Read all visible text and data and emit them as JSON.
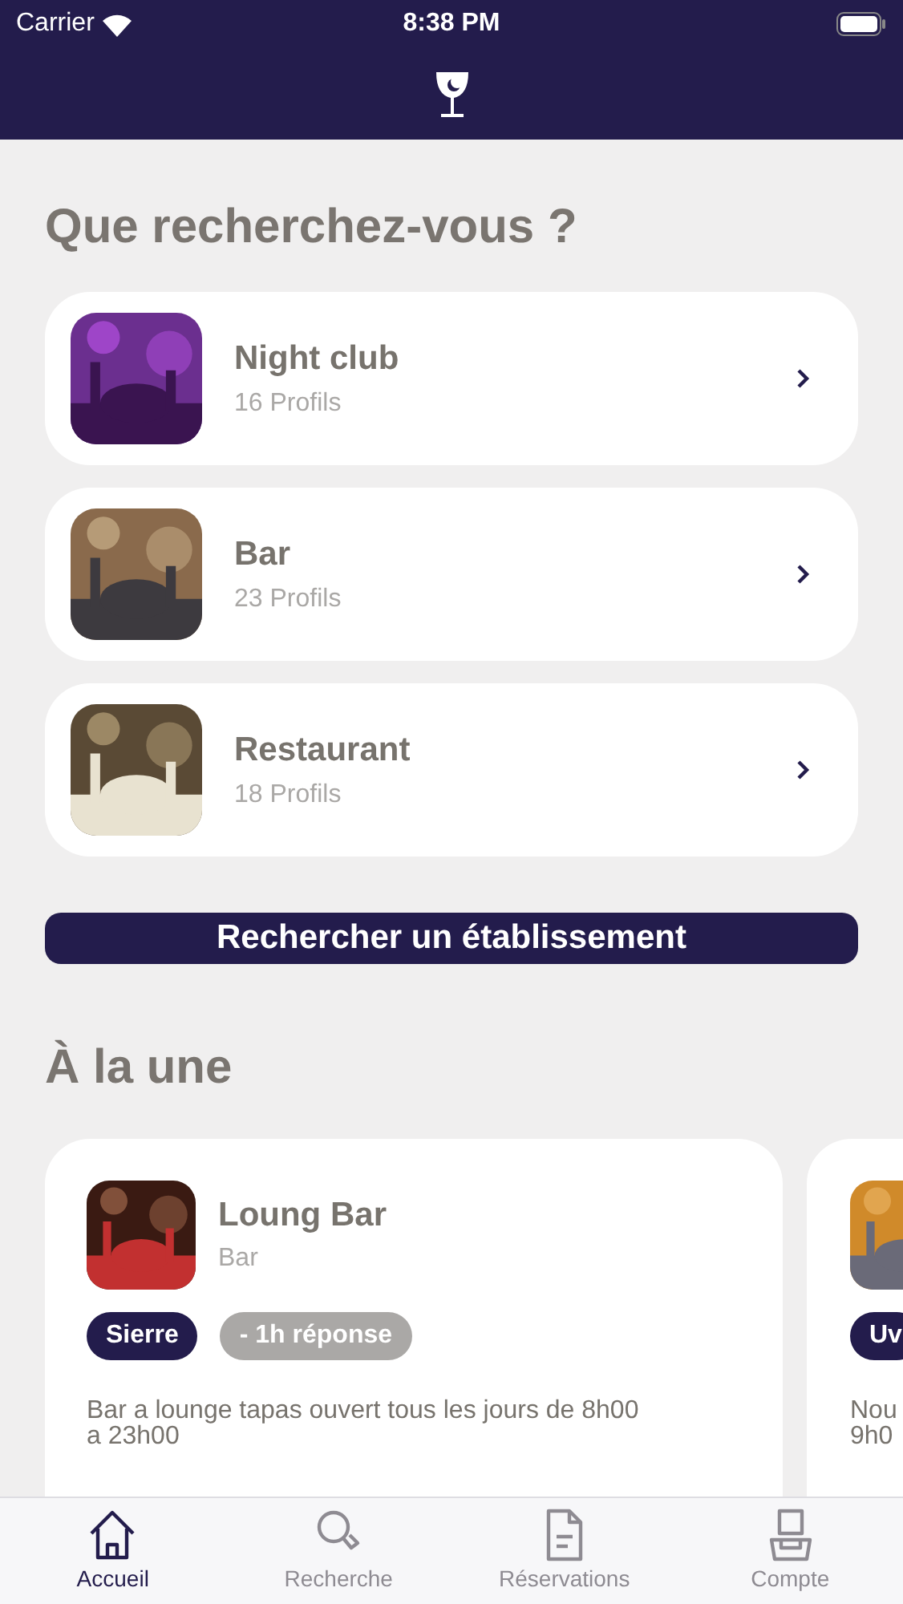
{
  "status_bar": {
    "carrier": "Carrier",
    "time": "8:38 PM"
  },
  "heading": "Que recherchez-vous ?",
  "categories": [
    {
      "name": "Night club",
      "count": "16 Profils"
    },
    {
      "name": "Bar",
      "count": "23 Profils"
    },
    {
      "name": "Restaurant",
      "count": "18 Profils"
    }
  ],
  "search_button": "Rechercher un établissement",
  "featured_heading": "À la une",
  "featured": [
    {
      "name": "Loung Bar",
      "type": "Bar",
      "tags": [
        {
          "label": "Sierre",
          "kind": "place"
        },
        {
          "label": "- 1h réponse",
          "kind": "info"
        }
      ],
      "description": "Bar a lounge tapas ouvert tous les jours de 8h00 a 23h00"
    },
    {
      "tags": [
        {
          "label": "Uv",
          "kind": "place"
        }
      ],
      "description": "Nou 9h0"
    }
  ],
  "tabs": [
    {
      "label": "Accueil",
      "selected": true
    },
    {
      "label": "Recherche",
      "selected": false
    },
    {
      "label": "Réservations",
      "selected": false
    },
    {
      "label": "Compte",
      "selected": false
    }
  ]
}
